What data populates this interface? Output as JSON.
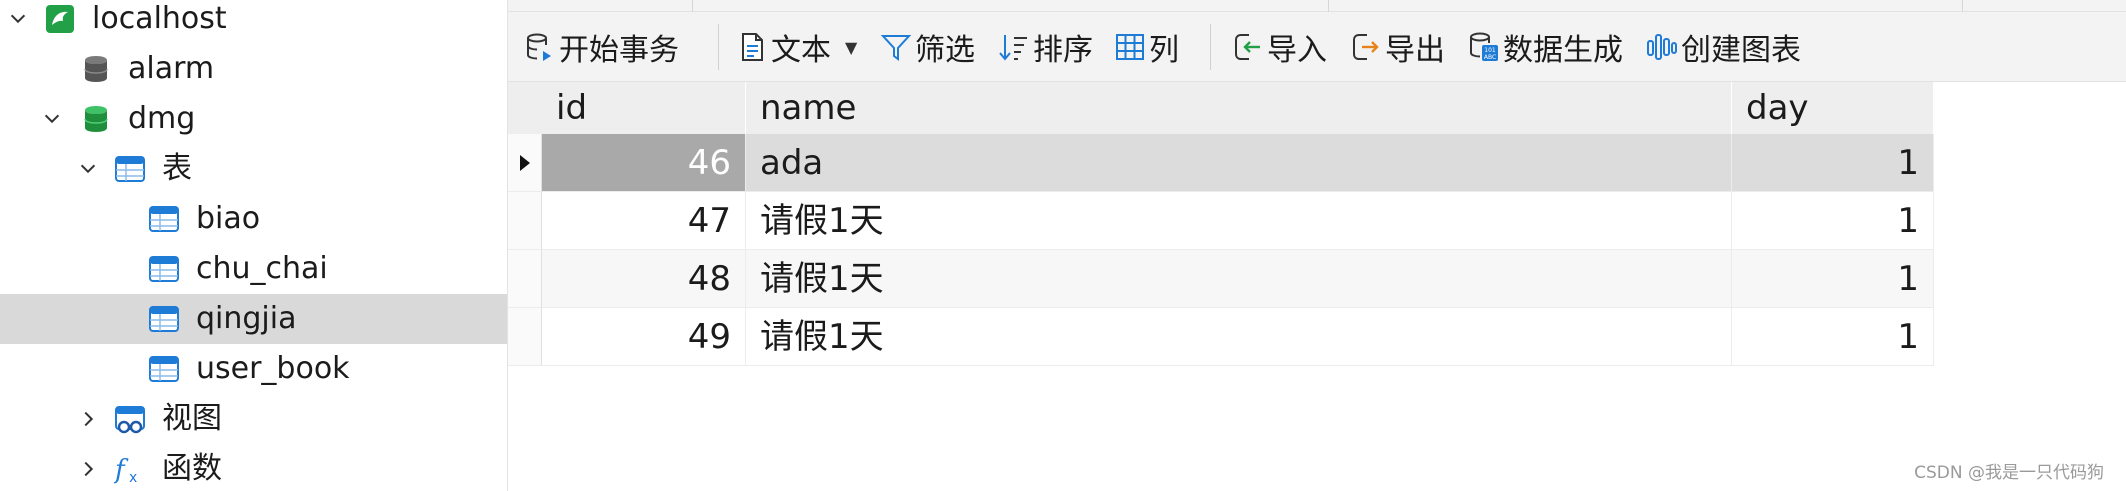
{
  "tree": {
    "nodes": [
      {
        "label": "localhost",
        "icon": "mysql-connection-icon",
        "expanded": true
      },
      {
        "label": "alarm",
        "icon": "database-gray-icon"
      },
      {
        "label": "dmg",
        "icon": "database-green-icon",
        "expanded": true
      },
      {
        "label": "表",
        "icon": "tables-folder-icon",
        "expanded": true
      },
      {
        "label": "biao",
        "icon": "table-icon"
      },
      {
        "label": "chu_chai",
        "icon": "table-icon"
      },
      {
        "label": "qingjia",
        "icon": "table-icon",
        "selected": true
      },
      {
        "label": "user_book",
        "icon": "table-icon"
      },
      {
        "label": "视图",
        "icon": "views-icon",
        "expanded": false
      },
      {
        "label": "函数",
        "icon": "functions-icon",
        "expanded": false
      }
    ]
  },
  "toolbar": {
    "begin_transaction": "开始事务",
    "text": "文本",
    "filter": "筛选",
    "sort": "排序",
    "columns": "列",
    "import": "导入",
    "export": "导出",
    "data_generation": "数据生成",
    "create_chart": "创建图表"
  },
  "grid": {
    "columns": [
      "id",
      "name",
      "day"
    ],
    "rows": [
      {
        "id": "46",
        "name": "ada",
        "day": "1",
        "current": true
      },
      {
        "id": "47",
        "name": "请假1天",
        "day": "1"
      },
      {
        "id": "48",
        "name": "请假1天",
        "day": "1"
      },
      {
        "id": "49",
        "name": "请假1天",
        "day": "1"
      }
    ]
  },
  "colors": {
    "accent_blue": "#1e7bd6",
    "db_green": "#21a047",
    "selection_gray": "#d9d9d9",
    "current_cell": "#a9a9a9"
  },
  "watermark": "CSDN @我是一只代码狗"
}
